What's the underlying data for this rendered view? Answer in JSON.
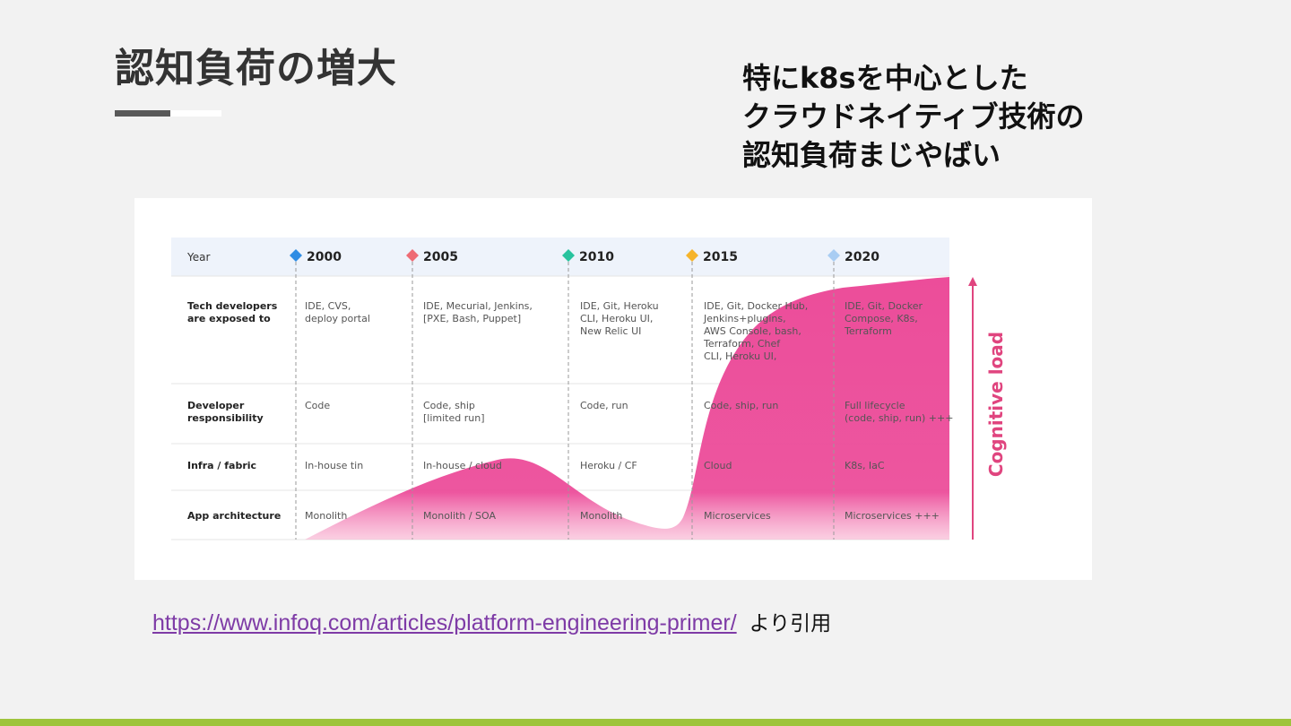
{
  "slide": {
    "title": "認知負荷の増大",
    "callout_lines": [
      "特にk8sを中心とした",
      "クラウドネイティブ技術の",
      "認知負荷まじやばい"
    ]
  },
  "figure": {
    "header_label": "Year",
    "years": [
      {
        "label": "2000",
        "color": "#2f8de4"
      },
      {
        "label": "2005",
        "color": "#ee6b74"
      },
      {
        "label": "2010",
        "color": "#28c39e"
      },
      {
        "label": "2015",
        "color": "#f6b42a"
      },
      {
        "label": "2020",
        "color": "#a9cdf3"
      }
    ],
    "rows": [
      {
        "label": [
          "Tech developers",
          "are exposed to"
        ],
        "cells": [
          [
            "IDE, CVS,",
            "deploy portal"
          ],
          [
            "IDE, Mecurial, Jenkins,",
            "[PXE, Bash, Puppet]"
          ],
          [
            "IDE, Git, Heroku",
            "CLI, Heroku UI,",
            "New Relic UI"
          ],
          [
            "IDE, Git, Docker Hub,",
            "Jenkins+plugins,",
            "AWS Console, bash,",
            "Terraform, Chef",
            "CLI, Heroku UI,"
          ],
          [
            "IDE, Git, Docker",
            "Compose, K8s,",
            "Terraform"
          ]
        ]
      },
      {
        "label": [
          "Developer",
          "responsibility"
        ],
        "cells": [
          [
            "Code"
          ],
          [
            "Code, ship",
            "[limited run]"
          ],
          [
            "Code, run"
          ],
          [
            "Code, ship, run"
          ],
          [
            "Full lifecycle",
            "(code, ship, run) +++"
          ]
        ]
      },
      {
        "label": [
          "Infra / fabric"
        ],
        "cells": [
          [
            "In-house tin"
          ],
          [
            "In-house / cloud"
          ],
          [
            "Heroku / CF"
          ],
          [
            "Cloud"
          ],
          [
            "K8s, IaC"
          ]
        ]
      },
      {
        "label": [
          "App architecture"
        ],
        "cells": [
          [
            "Monolith"
          ],
          [
            "Monolith / SOA"
          ],
          [
            "Monolith"
          ],
          [
            "Microservices"
          ],
          [
            "Microservices +++"
          ]
        ]
      }
    ],
    "axis_label": "Cognitive load",
    "colors": {
      "load_fill": "#ec4d9a",
      "header_bg": "#eef3fb",
      "axis": "#e0457f"
    }
  },
  "citation": {
    "url": "https://www.infoq.com/articles/platform-engineering-primer/",
    "suffix": "より引用",
    "link_color": "#7e3ba6"
  },
  "theme": {
    "accent_bar": "#9ec43c"
  }
}
